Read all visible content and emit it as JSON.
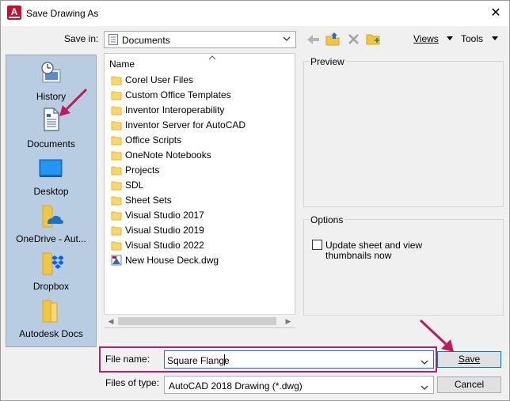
{
  "window": {
    "title": "Save Drawing As",
    "close_glyph": "✕",
    "app_icon_letter": "A"
  },
  "save_in": {
    "label": "Save in:",
    "value": "Documents"
  },
  "toolbar": {
    "views": "Views",
    "tools": "Tools"
  },
  "places": [
    {
      "name": "History",
      "icon": "history-icon"
    },
    {
      "name": "Documents",
      "icon": "documents-icon"
    },
    {
      "name": "Desktop",
      "icon": "desktop-icon"
    },
    {
      "name": "OneDrive - Aut...",
      "icon": "onedrive-icon"
    },
    {
      "name": "Dropbox",
      "icon": "dropbox-icon"
    },
    {
      "name": "Autodesk Docs",
      "icon": "autodesk-docs-icon"
    }
  ],
  "file_list": {
    "header": "Name",
    "items": [
      {
        "name": "Corel User Files",
        "type": "folder"
      },
      {
        "name": "Custom Office Templates",
        "type": "folder"
      },
      {
        "name": "Inventor Interoperability",
        "type": "folder"
      },
      {
        "name": "Inventor Server for AutoCAD",
        "type": "folder"
      },
      {
        "name": "Office Scripts",
        "type": "folder"
      },
      {
        "name": "OneNote Notebooks",
        "type": "folder"
      },
      {
        "name": "Projects",
        "type": "folder"
      },
      {
        "name": "SDL",
        "type": "folder"
      },
      {
        "name": "Sheet Sets",
        "type": "folder"
      },
      {
        "name": "Visual Studio 2017",
        "type": "folder"
      },
      {
        "name": "Visual Studio 2019",
        "type": "folder"
      },
      {
        "name": "Visual Studio 2022",
        "type": "folder"
      },
      {
        "name": "New House Deck.dwg",
        "type": "dwg"
      }
    ]
  },
  "preview": {
    "label": "Preview"
  },
  "options": {
    "label": "Options",
    "checkbox_label_line1": "Update sheet and view",
    "checkbox_label_line2": "thumbnails now",
    "checked": false
  },
  "file_name": {
    "label": "File name:",
    "value": "Square Flange"
  },
  "file_type": {
    "label": "Files of type:",
    "value": "AutoCAD 2018 Drawing (*.dwg)"
  },
  "buttons": {
    "save": "Save",
    "cancel": "Cancel"
  },
  "colors": {
    "accent_arrow": "#c2185b",
    "places_bg": "#b9cde2",
    "app_icon": "#c8102e"
  }
}
